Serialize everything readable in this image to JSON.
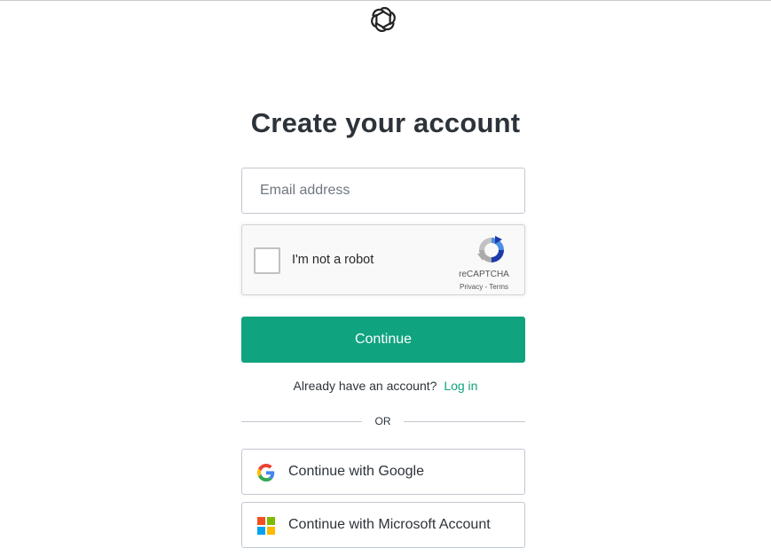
{
  "page": {
    "title": "Create your account"
  },
  "email": {
    "placeholder": "Email address",
    "value": ""
  },
  "recaptcha": {
    "label": "I'm not a robot",
    "brand": "reCAPTCHA",
    "privacy": "Privacy",
    "separator": " - ",
    "terms": "Terms",
    "checked": false
  },
  "continue_button": {
    "label": "Continue",
    "color": "#10a37f"
  },
  "login_prompt": {
    "text": "Already have an account?",
    "link": "Log in"
  },
  "divider": {
    "text": "OR"
  },
  "social": {
    "google_label": "Continue with Google",
    "google_icon": "google-icon",
    "microsoft_label": "Continue with Microsoft Account",
    "microsoft_icon": "microsoft-icon"
  },
  "colors": {
    "accent": "#10a37f",
    "text": "#2d333a",
    "border": "#c2c8d0"
  }
}
